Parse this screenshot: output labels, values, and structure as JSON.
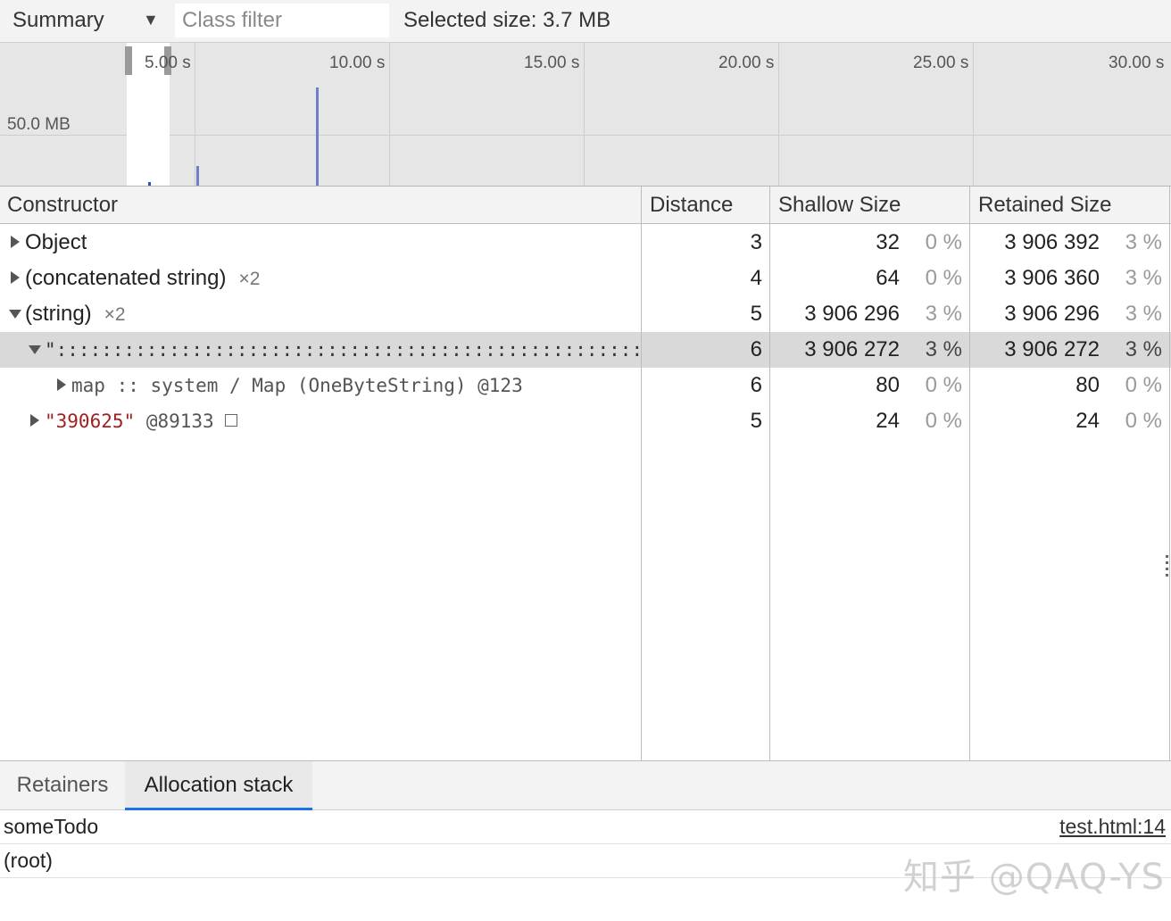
{
  "toolbar": {
    "view": "Summary",
    "class_filter_placeholder": "Class filter",
    "selected_size": "Selected size: 3.7 MB"
  },
  "overview": {
    "ticks": [
      "5.00 s",
      "10.00 s",
      "15.00 s",
      "20.00 s",
      "25.00 s",
      "30.00 s"
    ],
    "memory_label": "50.0 MB",
    "bar_color": "#6f7ec8"
  },
  "grid": {
    "headers": {
      "constructor": "Constructor",
      "distance": "Distance",
      "shallow": "Shallow Size",
      "retained": "Retained Size"
    },
    "rows": [
      {
        "name": "Object",
        "count": "",
        "distance": "3",
        "shallow": "32",
        "shallow_pct": "0 %",
        "retained": "3 906 392",
        "retained_pct": "3 %"
      },
      {
        "name": "(concatenated string)",
        "count": "×2",
        "distance": "4",
        "shallow": "64",
        "shallow_pct": "0 %",
        "retained": "3 906 360",
        "retained_pct": "3 %"
      },
      {
        "name": "(string)",
        "count": "×2",
        "distance": "5",
        "shallow": "3 906 296",
        "shallow_pct": "3 %",
        "retained": "3 906 296",
        "retained_pct": "3 %"
      },
      {
        "name": "\"::::::::::::::::::::::::::::::::::::::::::::::::::::::::::::::",
        "count": "",
        "distance": "6",
        "shallow": "3 906 272",
        "shallow_pct": "3 %",
        "retained": "3 906 272",
        "retained_pct": "3 %"
      },
      {
        "name": "map :: system / Map (OneByteString) @123",
        "count": "",
        "distance": "6",
        "shallow": "80",
        "shallow_pct": "0 %",
        "retained": "80",
        "retained_pct": "0 %"
      },
      {
        "name": "\"390625\"",
        "node_id": "@89133",
        "count": "",
        "distance": "5",
        "shallow": "24",
        "shallow_pct": "0 %",
        "retained": "24",
        "retained_pct": "0 %"
      }
    ]
  },
  "bottom": {
    "tabs": [
      "Retainers",
      "Allocation stack"
    ],
    "active_tab": "Allocation stack",
    "stack": [
      {
        "fn": "someTodo",
        "location": "test.html:14"
      },
      {
        "fn": "(root)",
        "location": ""
      }
    ]
  },
  "watermark": "知乎 @QAQ-YS",
  "colors": {
    "accent": "#1a73e8",
    "string_literal": "#a32020",
    "selected_row": "#d9d9d9"
  }
}
